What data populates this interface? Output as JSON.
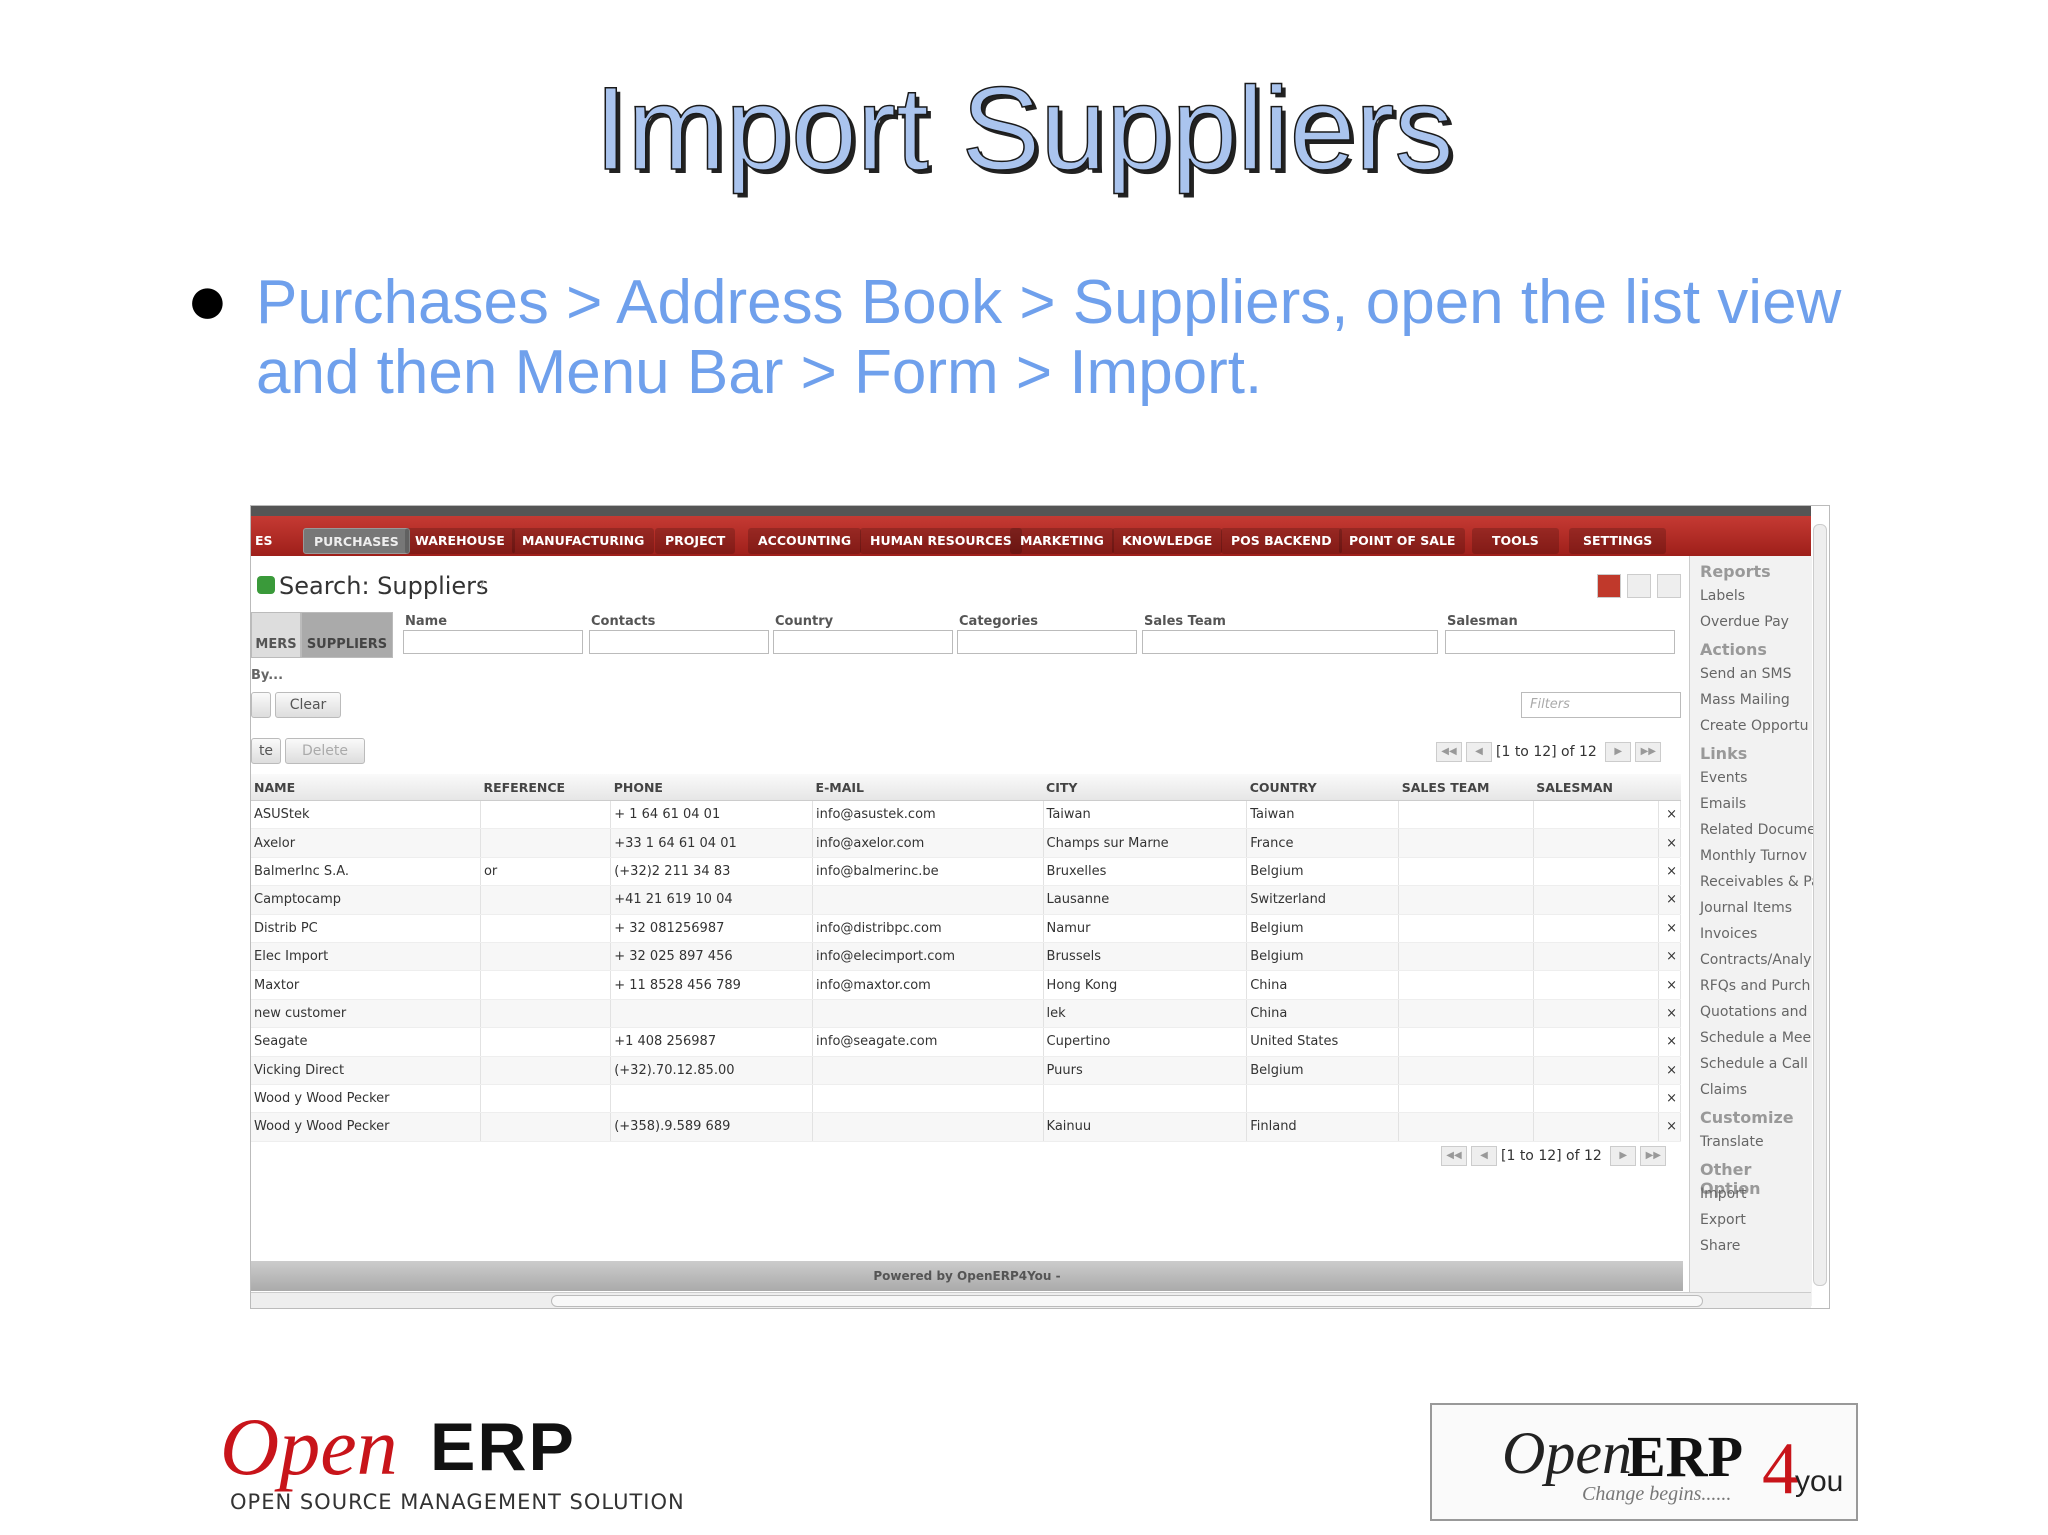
{
  "slide": {
    "title": "Import Suppliers",
    "bullet": "Purchases > Address Book > Suppliers, open the list view and then Menu Bar > Form > Import."
  },
  "app": {
    "nav_tabs": [
      "ES",
      "PURCHASES",
      "WAREHOUSE",
      "MANUFACTURING",
      "PROJECT",
      "ACCOUNTING",
      "HUMAN RESOURCES",
      "MARKETING",
      "KNOWLEDGE",
      "POS BACKEND",
      "POINT OF SALE",
      "TOOLS",
      "SETTINGS"
    ],
    "active_tab": "PURCHASES",
    "search_title": "Search: Suppliers",
    "help_mark": "?",
    "selector_tabs": [
      "MERS",
      "SUPPLIERS"
    ],
    "fields": {
      "name": "Name",
      "contacts": "Contacts",
      "country": "Country",
      "categories": "Categories",
      "sales_team": "Sales Team",
      "salesman": "Salesman"
    },
    "group_by": "By...",
    "clear_label": "Clear",
    "filters_placeholder": "Filters",
    "create_label": "te",
    "delete_label": "Delete",
    "pager_text": "[1 to 12] of 12",
    "columns": [
      "NAME",
      "REFERENCE",
      "PHONE",
      "E-MAIL",
      "CITY",
      "COUNTRY",
      "SALES TEAM",
      "SALESMAN"
    ],
    "rows": [
      {
        "name": "ASUStek",
        "reference": "",
        "phone": "+ 1 64 61 04 01",
        "email": "info@asustek.com",
        "city": "Taiwan",
        "country": "Taiwan"
      },
      {
        "name": "Axelor",
        "reference": "",
        "phone": "+33 1 64 61 04 01",
        "email": "info@axelor.com",
        "city": "Champs sur Marne",
        "country": "France"
      },
      {
        "name": "BalmerInc S.A.",
        "reference": "or",
        "phone": "(+32)2 211 34 83",
        "email": "info@balmerinc.be",
        "city": "Bruxelles",
        "country": "Belgium"
      },
      {
        "name": "Camptocamp",
        "reference": "",
        "phone": "+41 21 619 10 04",
        "email": "",
        "city": "Lausanne",
        "country": "Switzerland"
      },
      {
        "name": "Distrib PC",
        "reference": "",
        "phone": "+ 32 081256987",
        "email": "info@distribpc.com",
        "city": "Namur",
        "country": "Belgium"
      },
      {
        "name": "Elec Import",
        "reference": "",
        "phone": "+ 32 025 897 456",
        "email": "info@elecimport.com",
        "city": "Brussels",
        "country": "Belgium"
      },
      {
        "name": "Maxtor",
        "reference": "",
        "phone": "+ 11 8528 456 789",
        "email": "info@maxtor.com",
        "city": "Hong Kong",
        "country": "China"
      },
      {
        "name": "new customer",
        "reference": "",
        "phone": "",
        "email": "",
        "city": "lek",
        "country": "China"
      },
      {
        "name": "Seagate",
        "reference": "",
        "phone": "+1 408 256987",
        "email": "info@seagate.com",
        "city": "Cupertino",
        "country": "United States"
      },
      {
        "name": "Vicking Direct",
        "reference": "",
        "phone": "(+32).70.12.85.00",
        "email": "",
        "city": "Puurs",
        "country": "Belgium"
      },
      {
        "name": "Wood y Wood Pecker",
        "reference": "",
        "phone": "",
        "email": "",
        "city": "",
        "country": ""
      },
      {
        "name": "Wood y Wood Pecker",
        "reference": "",
        "phone": "(+358).9.589 689",
        "email": "",
        "city": "Kainuu",
        "country": "Finland"
      }
    ],
    "sidebar": {
      "reports_head": "Reports",
      "reports": [
        "Labels",
        "Overdue Pay"
      ],
      "actions_head": "Actions",
      "actions": [
        "Send an SMS",
        "Mass Mailing",
        "Create Opportu"
      ],
      "links_head": "Links",
      "links": [
        "Events",
        "Emails",
        "Related Docume",
        "Monthly Turnov",
        "Receivables & Pa",
        "Journal Items",
        "Invoices",
        "Contracts/Analy",
        "RFQs and Purch",
        "Quotations and",
        "Schedule a Mee",
        "Schedule a Call",
        "Claims"
      ],
      "customize_head": "Customize",
      "customize": [
        "Translate"
      ],
      "other_head": "Other Option",
      "other": [
        "Import",
        "Export",
        "Share"
      ]
    },
    "footer": "Powered by OpenERP4You -"
  },
  "logos": {
    "left_open": "Open",
    "left_erp": "ERP",
    "left_tagline": "OPEN SOURCE MANAGEMENT SOLUTION",
    "right_open": "Open",
    "right_erp": "ERP",
    "right_four": "4",
    "right_you": "you",
    "right_tagline": "Change begins......"
  },
  "colors": {
    "title": "#aac4ee",
    "bullet": "#6fa0ec",
    "nav": "#b22a24",
    "logo_red": "#c8141a"
  }
}
